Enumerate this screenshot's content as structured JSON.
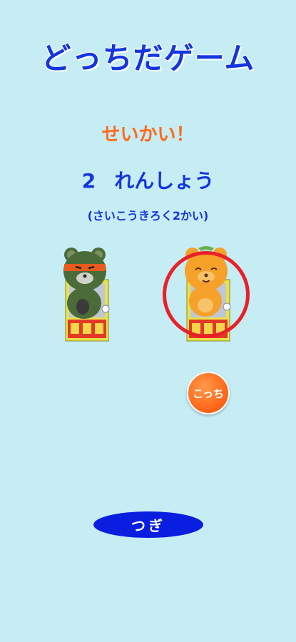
{
  "header": {
    "title": "どっちだゲーム"
  },
  "status": {
    "result": "せいかい！",
    "streak_number": "2",
    "streak_label": "れんしょう",
    "best_record": "(さいこうきろく2かい)"
  },
  "choices": {
    "correct_button": "こっち"
  },
  "footer": {
    "next_label": "つぎ"
  },
  "colors": {
    "background": "#c6ecf4",
    "title_blue": "#1336e0",
    "orange": "#ff6a1c",
    "circle_red": "#e8202a",
    "button_blue": "#0a1ee0"
  }
}
